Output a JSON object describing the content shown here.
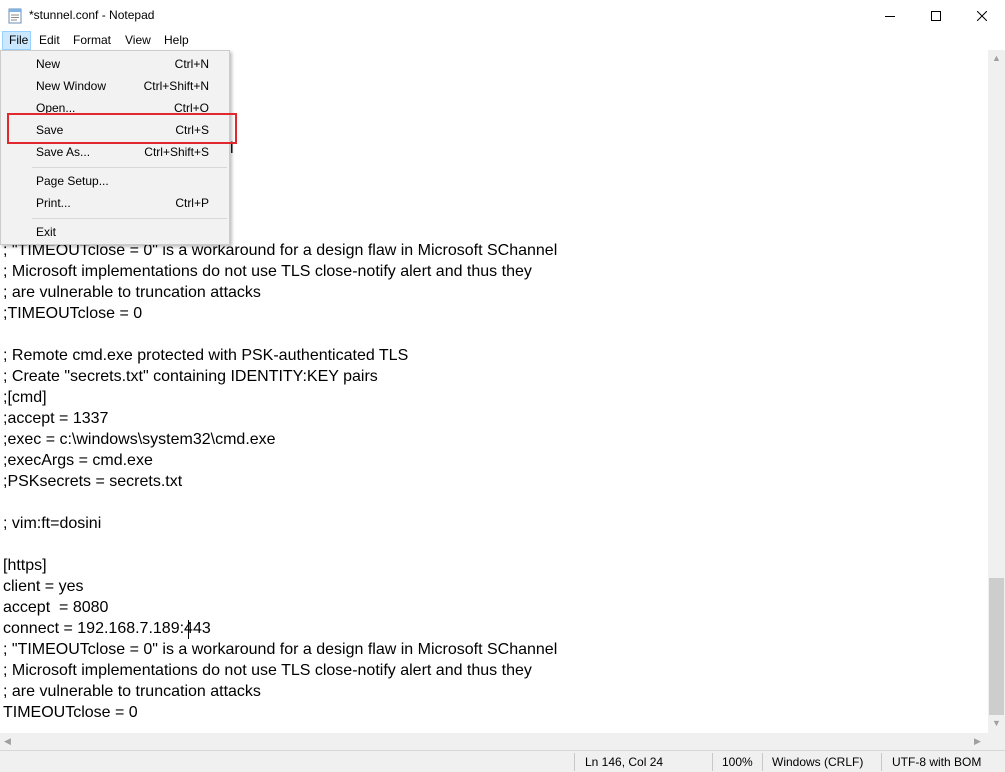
{
  "window": {
    "title": "*stunnel.conf - Notepad",
    "minimize_icon": "minimize-icon",
    "maximize_icon": "maximize-icon",
    "close_icon": "close-icon"
  },
  "menubar": {
    "file": "File",
    "edit": "Edit",
    "format": "Format",
    "view": "View",
    "help": "Help"
  },
  "file_menu": {
    "items": [
      {
        "label": "New",
        "shortcut": "Ctrl+N"
      },
      {
        "label": "New Window",
        "shortcut": "Ctrl+Shift+N"
      },
      {
        "label": "Open...",
        "shortcut": "Ctrl+O"
      },
      {
        "label": "Save",
        "shortcut": "Ctrl+S"
      },
      {
        "label": "Save As...",
        "shortcut": "Ctrl+Shift+S"
      },
      {
        "label": "Page Setup...",
        "shortcut": ""
      },
      {
        "label": "Print...",
        "shortcut": "Ctrl+P"
      },
      {
        "label": "Exit",
        "shortcut": ""
      }
    ],
    "highlighted": "Save"
  },
  "editor": {
    "lines": [
      "; \"TIMEOUTclose = 0\" is a workaround for a design flaw in Microsoft SChannel",
      "; Microsoft implementations do not use TLS close-notify alert and thus they",
      "; are vulnerable to truncation attacks",
      ";TIMEOUTclose = 0",
      "",
      "; Remote cmd.exe protected with PSK-authenticated TLS",
      "; Create \"secrets.txt\" containing IDENTITY:KEY pairs",
      ";[cmd]",
      ";accept = 1337",
      ";exec = c:\\windows\\system32\\cmd.exe",
      ";execArgs = cmd.exe",
      ";PSKsecrets = secrets.txt",
      "",
      "; vim:ft=dosini",
      "",
      "[https]",
      "client = yes",
      "accept  = 8080",
      "connect = 192.168.7.189:443",
      "; \"TIMEOUTclose = 0\" is a workaround for a design flaw in Microsoft SChannel",
      "; Microsoft implementations do not use TLS close-notify alert and thus they",
      "; are vulnerable to truncation attacks",
      "TIMEOUTclose = 0"
    ],
    "hidden_partial": "l"
  },
  "statusbar": {
    "position": "Ln 146, Col 24",
    "zoom": "100%",
    "line_ending": "Windows (CRLF)",
    "encoding": "UTF-8 with BOM"
  },
  "colors": {
    "menu_active_bg": "#cce8ff",
    "dropdown_bg": "#f2f2f2",
    "highlight_box": "#e0282e",
    "status_bg": "#f0f0f0"
  }
}
